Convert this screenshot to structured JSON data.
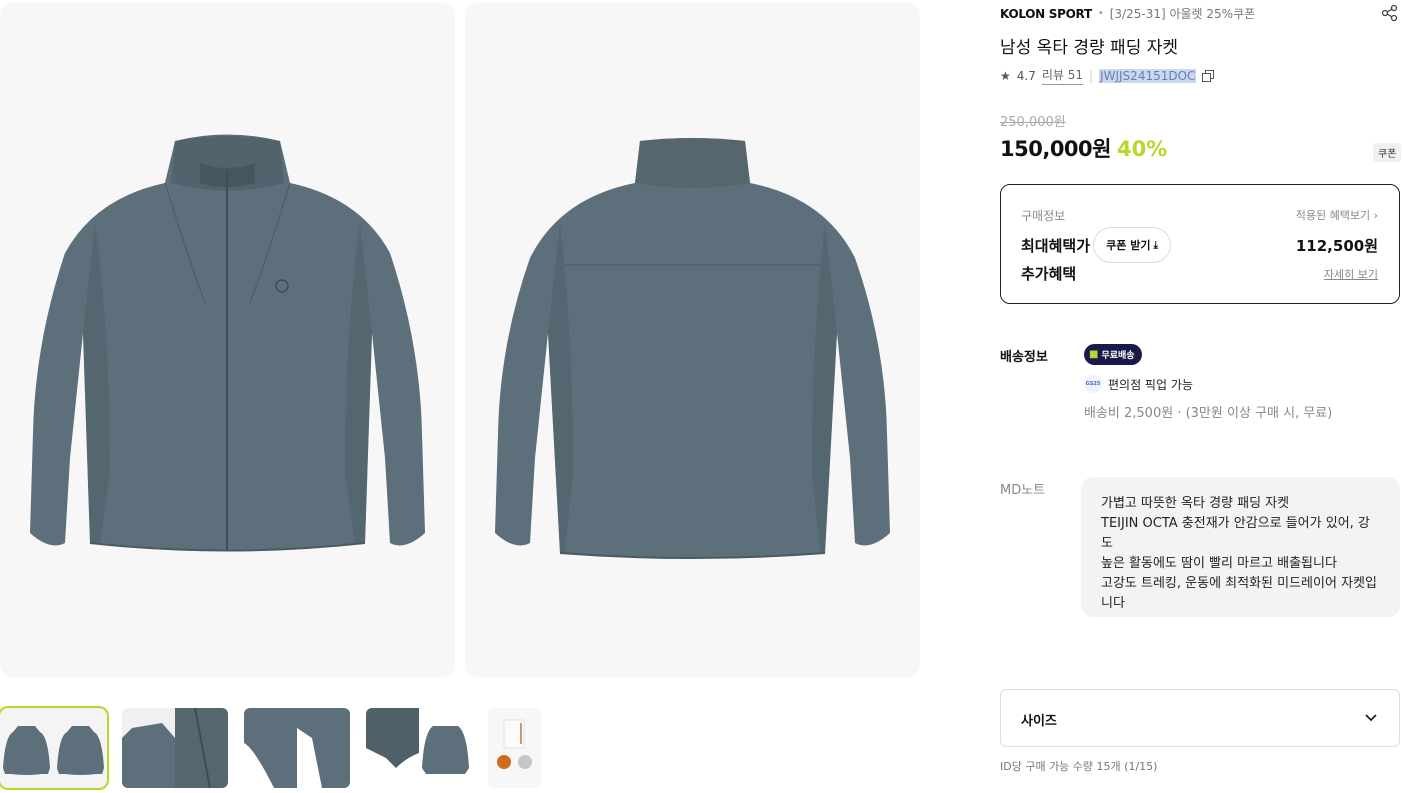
{
  "product": {
    "brand": "KOLON SPORT",
    "promo": "[3/25-31] 아울렛 25%쿠폰",
    "title": "남성 옥타 경량 패딩 자켓",
    "rating": "4.7",
    "review_label": "리뷰 51",
    "code": "JWJJS24151DOC",
    "original_price": "250,000원",
    "price": "150,000원",
    "discount": "40%",
    "coupon_badge": "쿠폰"
  },
  "benefit": {
    "purchase_info_label": "구매정보",
    "applied_link": "적용된 혜택보기 ›",
    "max_benefit_label": "최대혜택가",
    "coupon_button": "쿠폰 받기",
    "max_benefit_price": "112,500원",
    "extra_label": "추가혜택",
    "detail_link": "자세히 보기"
  },
  "shipping": {
    "label": "배송정보",
    "free_badge": "무료배송",
    "store_icon_text": "GS25",
    "pickup": "편의점 픽업 가능",
    "fee": "배송비 2,500원 · (3만원 이상 구매 시, 무료)"
  },
  "md": {
    "label": "MD노트",
    "lines": [
      "가볍고 따뜻한 옥타 경량 패딩 자켓",
      "TEIJIN OCTA 충전재가 안감으로 들어가 있어, 강도",
      "높은 활동에도 땀이 빨리 마르고 배출됩니다",
      "고강도 트레킹, 운동에 최적화된 미드레이어 자켓입",
      "니다"
    ]
  },
  "options": {
    "size_label": "사이즈",
    "limit": "ID당 구매 가능 수량 15개 (1/15)"
  },
  "gallery": {
    "images": [
      "jacket-front",
      "jacket-back"
    ],
    "thumbnails": [
      "front-back",
      "detail-collar",
      "detail-cuff",
      "detail-inner",
      "tag-label"
    ],
    "active_thumbnail": 0
  },
  "colors": {
    "jacket": "#5d6f7a",
    "accent_green": "#b5d82b",
    "free_badge_bg": "#1a1a4a"
  }
}
